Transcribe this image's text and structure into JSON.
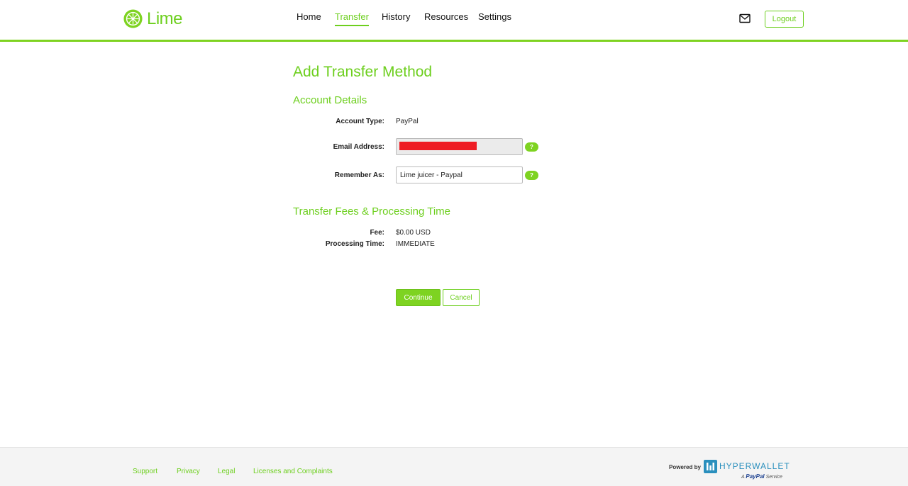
{
  "header": {
    "brand": "Lime",
    "nav": [
      {
        "label": "Home",
        "active": false
      },
      {
        "label": "Transfer",
        "active": true
      },
      {
        "label": "History",
        "active": false
      },
      {
        "label": "Resources",
        "active": false
      },
      {
        "label": "Settings",
        "active": false
      }
    ],
    "mail_icon": "envelope-icon",
    "logout_label": "Logout"
  },
  "main": {
    "title": "Add Transfer Method",
    "account_details": {
      "heading": "Account Details",
      "account_type_label": "Account Type:",
      "account_type_value": "PayPal",
      "email_label": "Email Address:",
      "email_value": "",
      "remember_label": "Remember As:",
      "remember_value": "Lime juicer - Paypal",
      "help_glyph": "?"
    },
    "fees": {
      "heading": "Transfer Fees & Processing Time",
      "fee_label": "Fee:",
      "fee_value": "$0.00 USD",
      "processing_label": "Processing Time:",
      "processing_value": "IMMEDIATE"
    },
    "continue_label": "Continue",
    "cancel_label": "Cancel"
  },
  "footer": {
    "links": [
      "Support",
      "Privacy",
      "Legal",
      "Licenses and Complaints"
    ],
    "powered_by": "Powered by",
    "provider": "HYPERWALLET",
    "provider_sub_prefix": "A",
    "provider_sub_brand": "PayPal",
    "provider_sub_suffix": "Service"
  },
  "colors": {
    "accent": "#7ed321",
    "accent_text": "#6dcf1e",
    "redaction": "#ee1c24",
    "hyperwallet": "#2a8fbd"
  }
}
